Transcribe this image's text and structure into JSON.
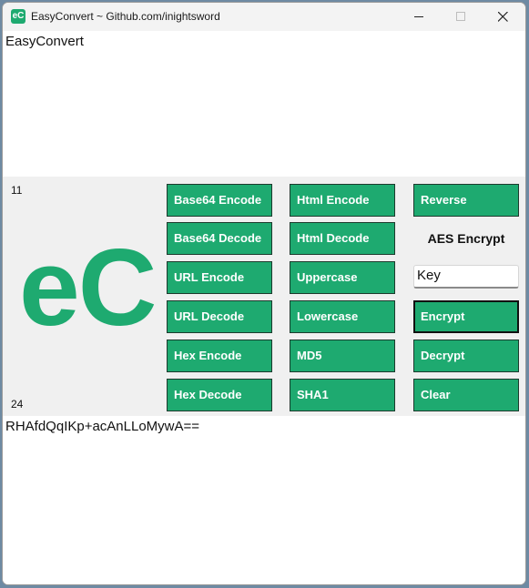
{
  "window": {
    "title": "EasyConvert ~ Github.com/inightsword",
    "icon_text": "eC"
  },
  "input": {
    "value": "EasyConvert"
  },
  "panel": {
    "input_length": "11",
    "output_length": "24",
    "logo_text": "eC"
  },
  "buttons": {
    "base64_encode": "Base64 Encode",
    "base64_decode": "Base64 Decode",
    "url_encode": "URL Encode",
    "url_decode": "URL Decode",
    "hex_encode": "Hex Encode",
    "hex_decode": "Hex Decode",
    "html_encode": "Html Encode",
    "html_decode": "Html Decode",
    "uppercase": "Uppercase",
    "lowercase": "Lowercase",
    "md5": "MD5",
    "sha1": "SHA1",
    "reverse": "Reverse",
    "encrypt": "Encrypt",
    "decrypt": "Decrypt",
    "clear": "Clear"
  },
  "aes": {
    "label": "AES Encrypt",
    "key_value": "Key"
  },
  "output": {
    "value": "RHAfdQqIKp+acAnLLoMywA=="
  },
  "colors": {
    "accent": "#1eaa70",
    "panel_bg": "#f0f0f0"
  }
}
